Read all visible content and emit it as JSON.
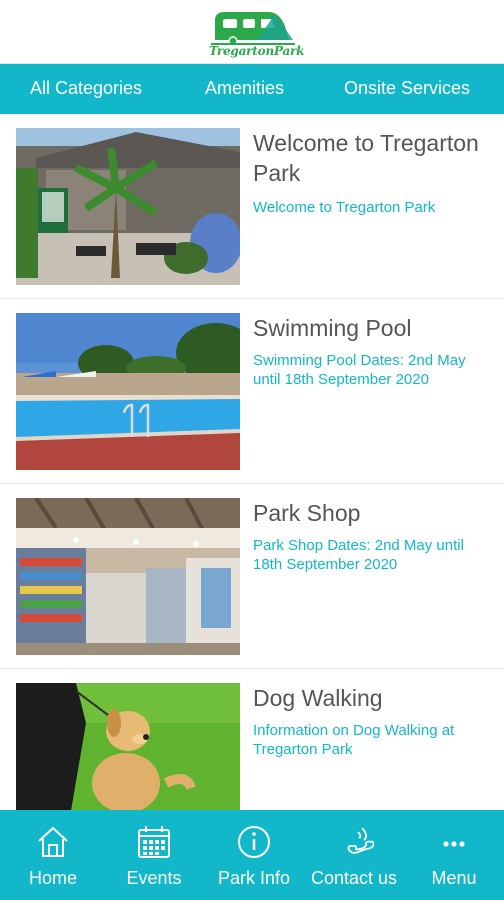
{
  "header": {
    "logo_text": "TregartonPark"
  },
  "tabs": [
    {
      "label": "All Categories"
    },
    {
      "label": "Amenities"
    },
    {
      "label": "Onsite Services"
    }
  ],
  "items": [
    {
      "title": "Welcome to Tregarton Park",
      "description": "Welcome to Tregarton Park"
    },
    {
      "title": "Swimming Pool",
      "description": "Swimming Pool Dates: 2nd May until 18th September 2020"
    },
    {
      "title": "Park Shop",
      "description": "Park Shop Dates: 2nd May until 18th September 2020"
    },
    {
      "title": "Dog Walking",
      "description": "Information on Dog Walking at Tregarton Park"
    }
  ],
  "bottom_nav": [
    {
      "label": "Home",
      "icon": "home-icon"
    },
    {
      "label": "Events",
      "icon": "calendar-icon"
    },
    {
      "label": "Park Info",
      "icon": "info-icon"
    },
    {
      "label": "Contact us",
      "icon": "phone-icon"
    },
    {
      "label": "Menu",
      "icon": "more-icon"
    }
  ],
  "colors": {
    "accent": "#12b7c9",
    "logo_green": "#2aa84a",
    "title_text": "#555555"
  }
}
